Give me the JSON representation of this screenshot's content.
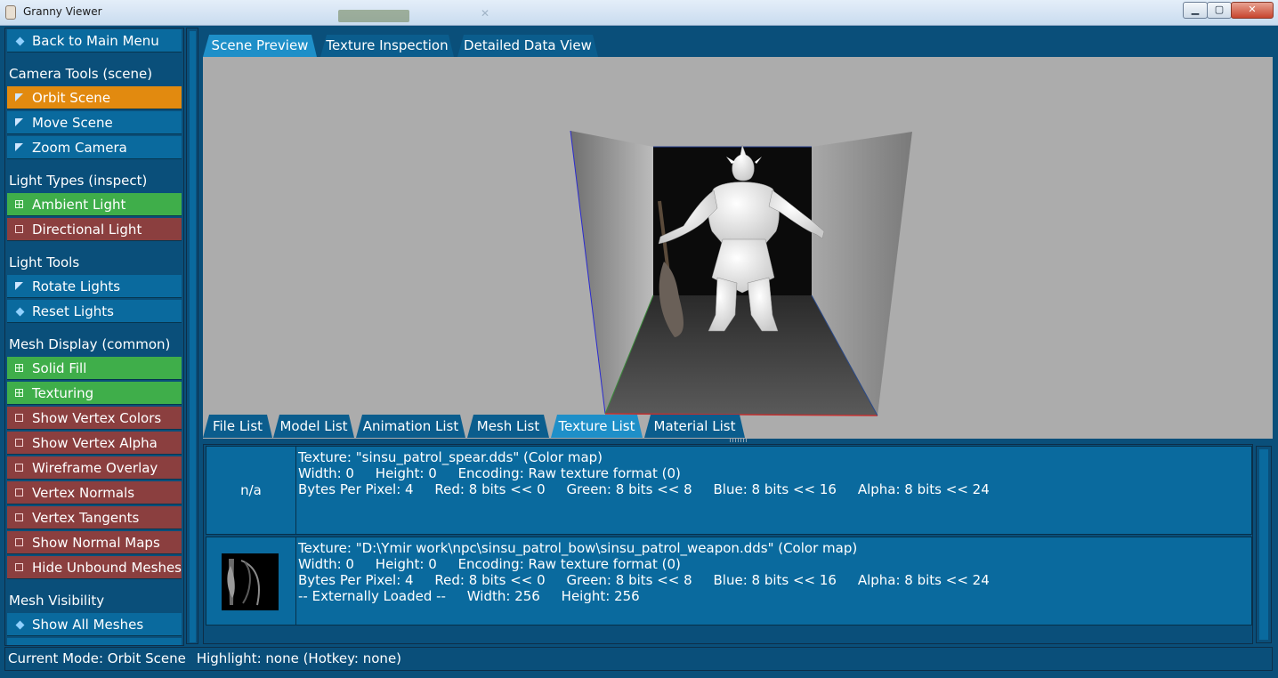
{
  "window": {
    "title": "Granny Viewer"
  },
  "sidebar": {
    "back": "Back to Main Menu",
    "sections": {
      "camera": "Camera Tools (scene)",
      "light_types": "Light Types (inspect)",
      "light_tools": "Light Tools",
      "mesh_display": "Mesh Display (common)",
      "mesh_visibility": "Mesh Visibility"
    },
    "camera_items": [
      "Orbit Scene",
      "Move Scene",
      "Zoom Camera"
    ],
    "light_type_items": [
      "Ambient Light",
      "Directional Light"
    ],
    "light_tool_items": [
      "Rotate Lights",
      "Reset Lights"
    ],
    "mesh_display_items": [
      "Solid Fill",
      "Texturing",
      "Show Vertex Colors",
      "Show Vertex Alpha",
      "Wireframe Overlay",
      "Vertex Normals",
      "Vertex Tangents",
      "Show Normal Maps",
      "Hide Unbound Meshes"
    ],
    "mesh_visibility_items": [
      "Show All Meshes"
    ]
  },
  "top_tabs": [
    "Scene Preview",
    "Texture Inspection",
    "Detailed Data View"
  ],
  "active_top_tab": "Scene Preview",
  "bottom_tabs": [
    "File List",
    "Model List",
    "Animation List",
    "Mesh List",
    "Texture List",
    "Material List"
  ],
  "active_bottom_tab": "Texture List",
  "textures": [
    {
      "thumb": "n/a",
      "lines": [
        "Texture: \"sinsu_patrol_spear.dds\" (Color map)",
        "Width: 0     Height: 0     Encoding: Raw texture format (0)",
        "Bytes Per Pixel: 4     Red: 8 bits << 0     Green: 8 bits << 8     Blue: 8 bits << 16     Alpha: 8 bits << 24"
      ]
    },
    {
      "thumb": "",
      "lines": [
        "Texture: \"D:\\Ymir work\\npc\\sinsu_patrol_bow\\sinsu_patrol_weapon.dds\" (Color map)",
        "Width: 0     Height: 0     Encoding: Raw texture format (0)",
        "Bytes Per Pixel: 4     Red: 8 bits << 0     Green: 8 bits << 8     Blue: 8 bits << 16     Alpha: 8 bits << 24",
        "-- Externally Loaded --     Width: 256     Height: 256"
      ]
    }
  ],
  "status": {
    "mode": "Current Mode: Orbit Scene",
    "highlight": "Highlight: none (Hotkey: none)"
  },
  "colors": {
    "panel": "#0a4f7a",
    "button_blue": "#0a6a9e",
    "active": "#e28a0f",
    "on": "#3fae4a",
    "off": "#8b3f3f",
    "tab_active": "#1e8fc8"
  }
}
